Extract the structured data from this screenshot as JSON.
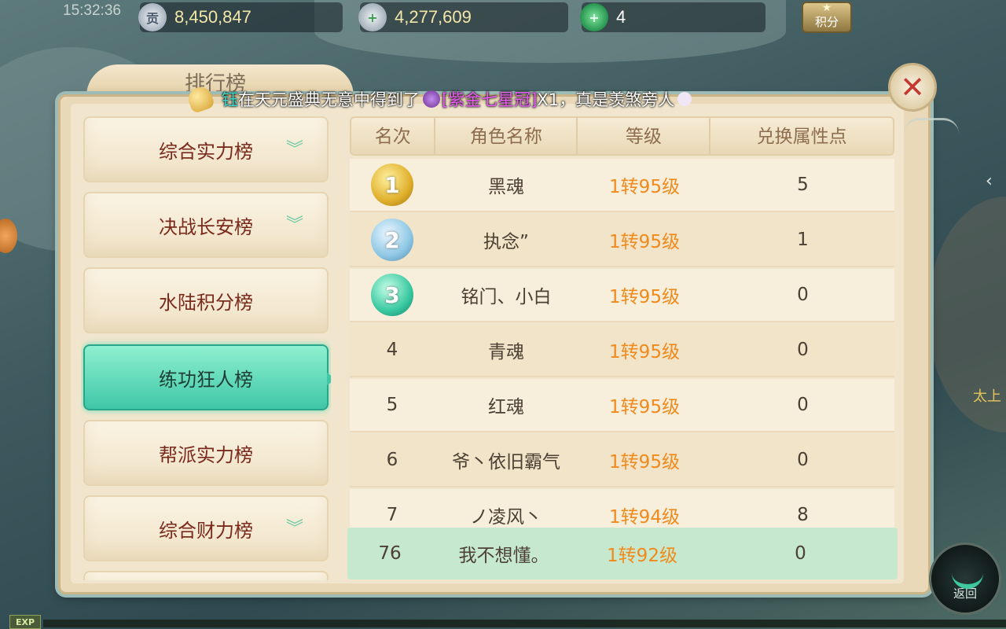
{
  "status": {
    "clock": "15:32:36"
  },
  "resources": [
    {
      "icon": "contribution-icon",
      "icon_text": "贡",
      "value": "8,450,847"
    },
    {
      "icon": "silver-ingot-add-icon",
      "icon_text": "+",
      "value": "4,277,609"
    },
    {
      "icon": "jade-add-icon",
      "icon_text": "+",
      "value": "4"
    }
  ],
  "score_button": {
    "label": "积分",
    "icon": "star-icon"
  },
  "window": {
    "title": "排行榜"
  },
  "broadcast": {
    "icon": "bell-icon",
    "player": "钰",
    "message": "在天元盛典无意中得到了",
    "item_icon": "crown-icon",
    "item": "[紫金七星冠]",
    "suffix": "X1，真是羡煞旁人",
    "emote_icon": "emote-icon"
  },
  "close_button": {
    "icon": "close-icon",
    "symbol": "✕"
  },
  "sidebar": {
    "items": [
      {
        "label": "综合实力榜",
        "has_dropdown": true,
        "active": false
      },
      {
        "label": "决战长安榜",
        "has_dropdown": true,
        "active": false
      },
      {
        "label": "水陆积分榜",
        "has_dropdown": false,
        "active": false
      },
      {
        "label": "练功狂人榜",
        "has_dropdown": false,
        "active": true
      },
      {
        "label": "帮派实力榜",
        "has_dropdown": false,
        "active": false
      },
      {
        "label": "综合财力榜",
        "has_dropdown": true,
        "active": false
      }
    ],
    "chevron": "︾"
  },
  "table": {
    "headers": [
      "名次",
      "角色名称",
      "等级",
      "兑换属性点"
    ],
    "rows": [
      {
        "rank": "1",
        "medal": "gold",
        "name": "黑魂",
        "level": "1转95级",
        "points": "5"
      },
      {
        "rank": "2",
        "medal": "silver",
        "name": "执念”",
        "level": "1转95级",
        "points": "1"
      },
      {
        "rank": "3",
        "medal": "jade",
        "name": "铭门、小白",
        "level": "1转95级",
        "points": "0"
      },
      {
        "rank": "4",
        "medal": "",
        "name": "青魂",
        "level": "1转95级",
        "points": "0"
      },
      {
        "rank": "5",
        "medal": "",
        "name": "红魂",
        "level": "1转95级",
        "points": "0"
      },
      {
        "rank": "6",
        "medal": "",
        "name": "爷丶依旧霸气",
        "level": "1转95级",
        "points": "0"
      },
      {
        "rank": "7",
        "medal": "",
        "name": "ノ凌风丶",
        "level": "1转94级",
        "points": "8"
      }
    ],
    "self_row": {
      "rank": "76",
      "name": "我不想懂。",
      "level": "1转92级",
      "points": "0"
    }
  },
  "bottom": {
    "exp_label": "EXP",
    "exp_progress": 0.0,
    "back_label": "返回"
  },
  "side": {
    "label": "太上"
  }
}
